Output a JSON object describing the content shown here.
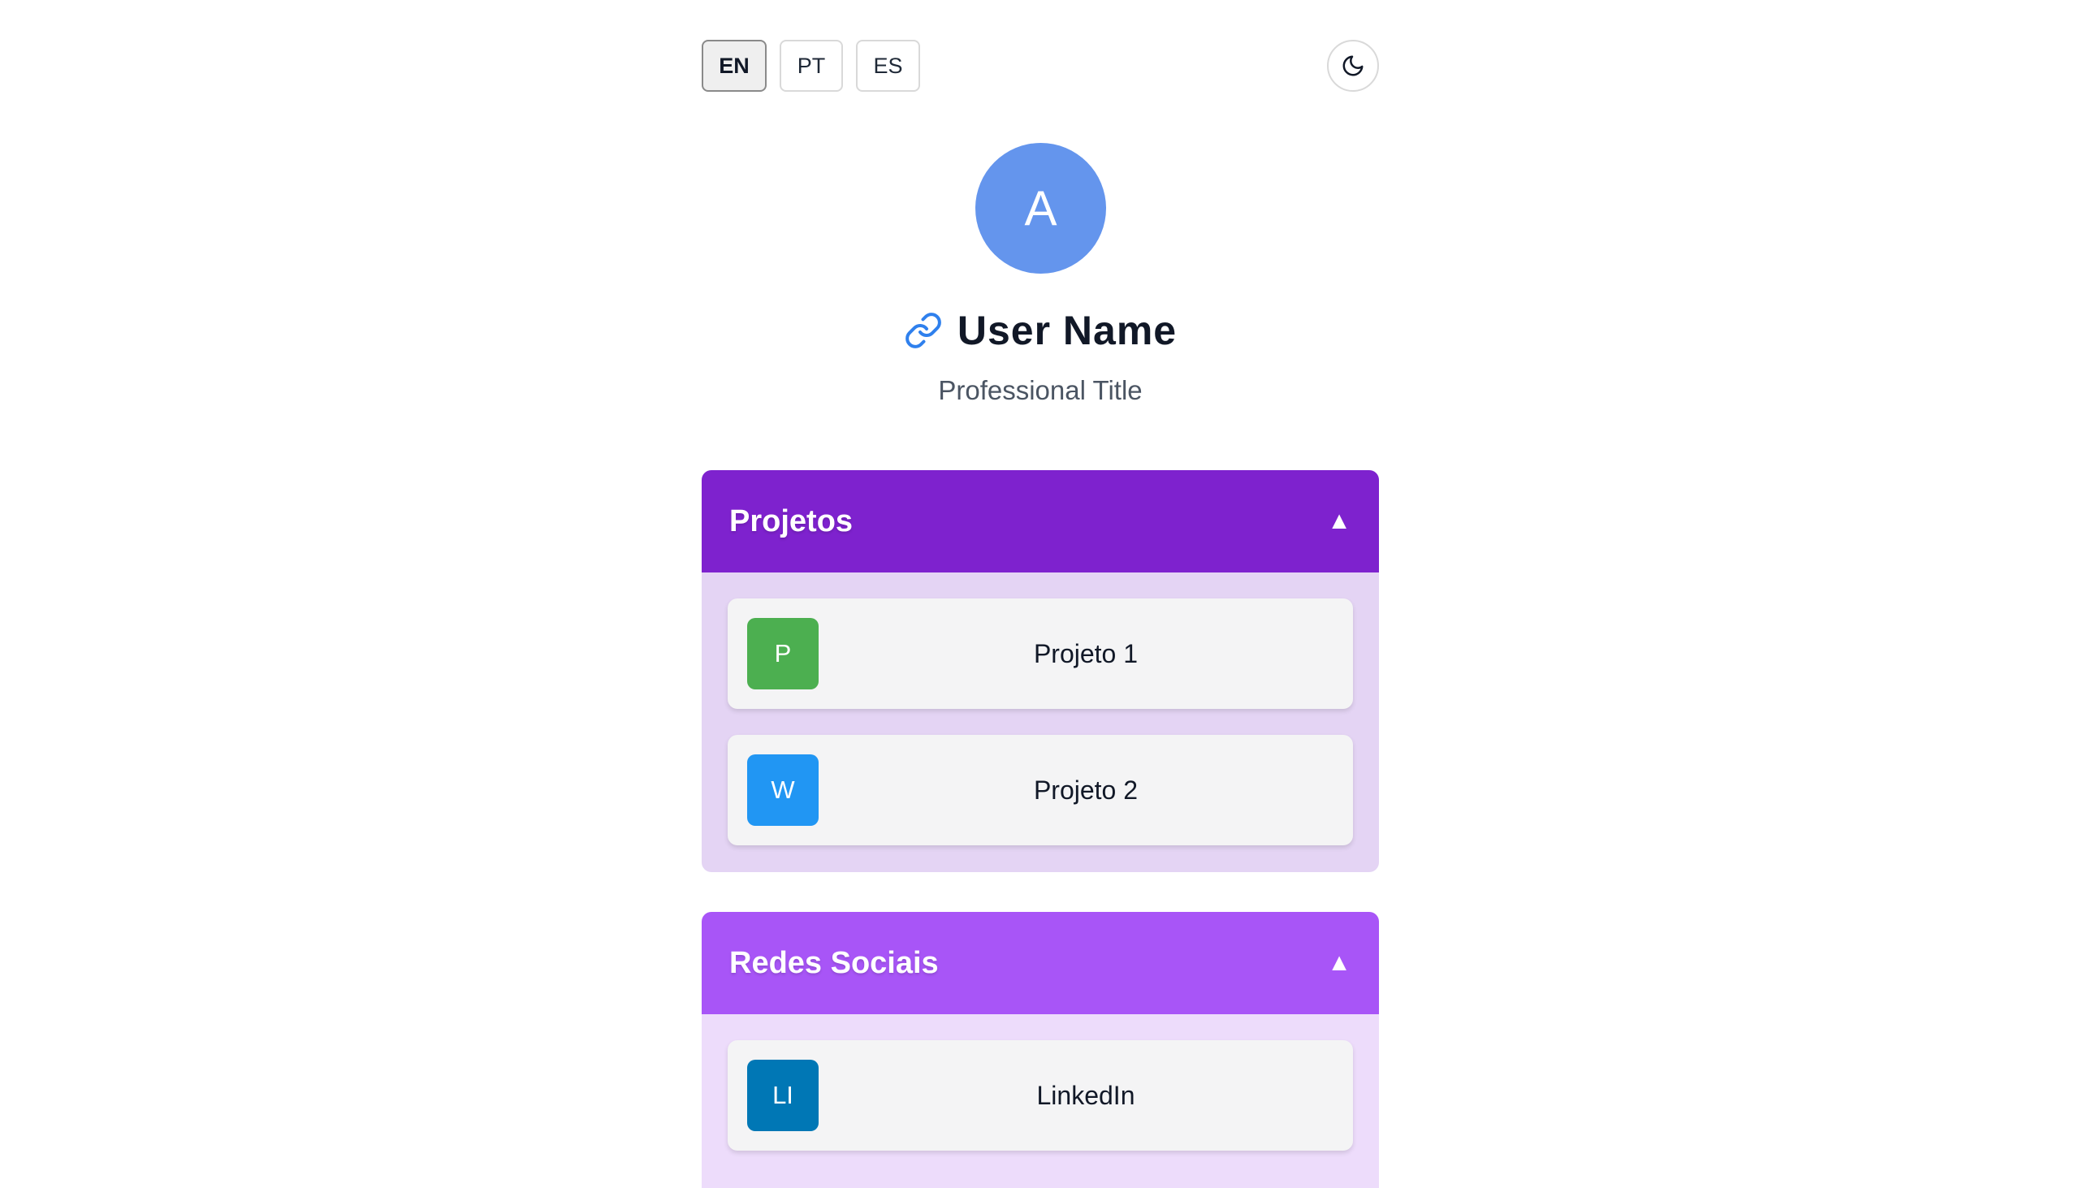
{
  "languages": [
    {
      "label": "EN",
      "active": true
    },
    {
      "label": "PT",
      "active": false
    },
    {
      "label": "ES",
      "active": false
    }
  ],
  "theme_toggle": {
    "icon": "moon-icon"
  },
  "profile": {
    "avatar_letter": "A",
    "avatar_color": "#6495ed",
    "name": "User Name",
    "link_icon": "link-icon",
    "title": "Professional Title"
  },
  "sections": [
    {
      "title": "Projetos",
      "arrow": "▲",
      "header_color": "#7e22ce",
      "body_color": "#e4d4f4",
      "items": [
        {
          "badge": "P",
          "badge_color": "#4caf50",
          "label": "Projeto 1"
        },
        {
          "badge": "W",
          "badge_color": "#2196f3",
          "label": "Projeto 2"
        }
      ]
    },
    {
      "title": "Redes Sociais",
      "arrow": "▲",
      "header_color": "#a855f7",
      "body_color": "#eddcfb",
      "items": [
        {
          "badge": "LI",
          "badge_color": "#0077b5",
          "label": "LinkedIn"
        }
      ]
    }
  ]
}
